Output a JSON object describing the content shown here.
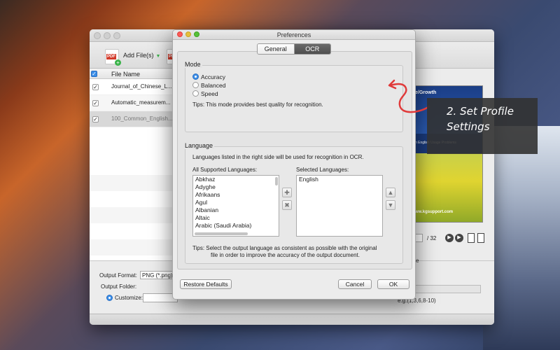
{
  "main": {
    "toolbar": {
      "add_files": "Add File(s)"
    },
    "file_list": {
      "header": "File Name",
      "files": [
        "Journal_of_Chinese_L...",
        "Automatic_measurem...",
        "100_Common_English..."
      ]
    },
    "preview": {
      "title_fragment": "e/Growth",
      "subtitle_fragment": "n English Usage Problems",
      "footer_fragment": "ww.kgsupport.com",
      "total_pages": "/ 32"
    },
    "output": {
      "format_label": "Output Format:",
      "format_value": "PNG (*.png)",
      "folder_label": "Output Folder:",
      "customize_label": "Customize:",
      "range_fragment": "e",
      "range_hint": "e.g.(1,3,6,8-10)"
    }
  },
  "preferences": {
    "title": "Preferences",
    "tabs": [
      "General",
      "OCR"
    ],
    "active_tab": "OCR",
    "mode": {
      "title": "Mode",
      "options": [
        "Accuracy",
        "Balanced",
        "Speed"
      ],
      "selected": "Accuracy",
      "tips": "Tips:  This mode provides best quality for recognition."
    },
    "language": {
      "title": "Language",
      "description": "Languages listed in the right side will be used for recognition in OCR.",
      "all_label": "All Supported Languages:",
      "selected_label": "Selected Languages:",
      "all_languages": [
        "Abkhaz",
        "Adyghe",
        "Afrikaans",
        "Agul",
        "Albanian",
        "Altaic",
        "Arabic (Saudi Arabia)"
      ],
      "selected_languages": [
        "English"
      ],
      "tips_line1": "Tips:  Select the output language as consistent as possible with the original",
      "tips_line2": "file in order to improve the accuracy of the output document."
    },
    "buttons": {
      "restore": "Restore Defaults",
      "cancel": "Cancel",
      "ok": "OK"
    }
  },
  "annotation": {
    "line1": "2. Set Profile",
    "line2": "Settings"
  },
  "colors": {
    "accent": "#3b8ee8",
    "arrow": "#e03a3a",
    "tab_active": "#565656"
  }
}
